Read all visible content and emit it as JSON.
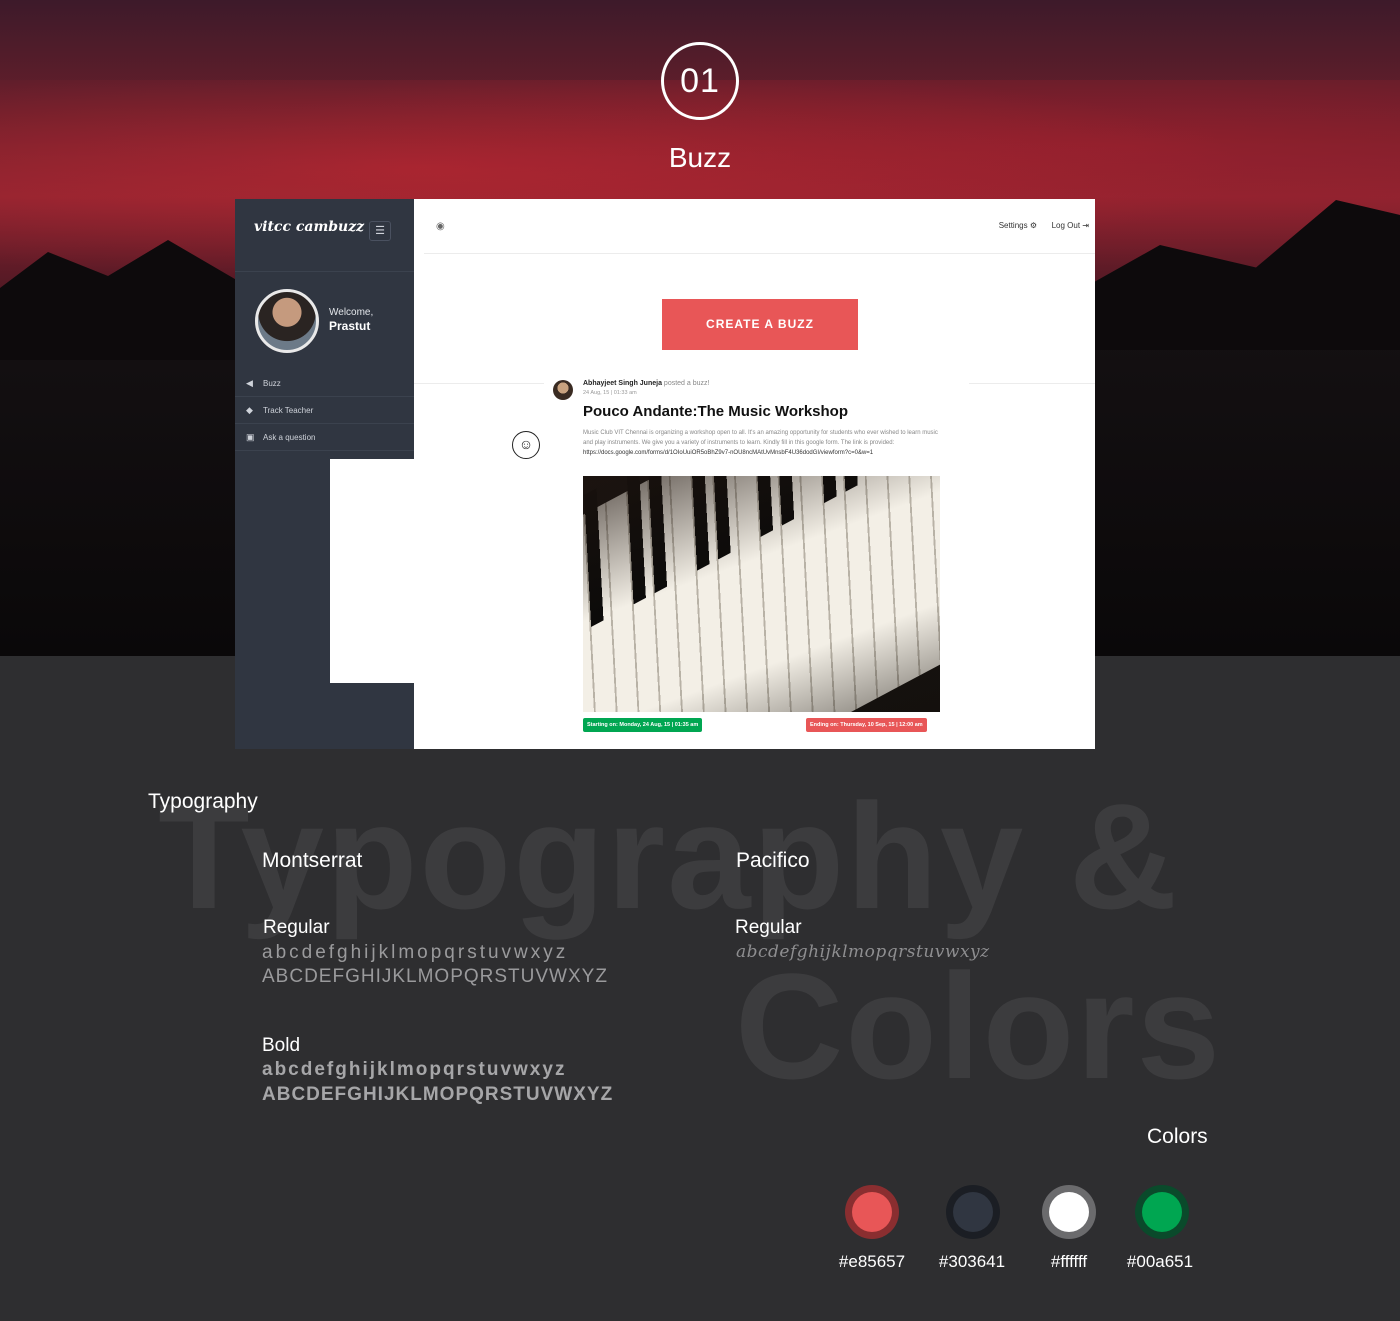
{
  "header": {
    "step_number": "01",
    "step_title": "Buzz"
  },
  "app": {
    "brand": "vitcc cambuzz",
    "menu_icon": "hamburger-icon",
    "user": {
      "welcome": "Welcome,",
      "name": "Prastut"
    },
    "nav": [
      {
        "label": "Buzz",
        "icon": "megaphone-icon"
      },
      {
        "label": "Track Teacher",
        "icon": "graduation-cap-icon"
      },
      {
        "label": "Ask a question",
        "icon": "question-screen-icon"
      }
    ],
    "topbar": {
      "settings": "Settings",
      "logout": "Log Out"
    },
    "create_button": "CREATE A BUZZ",
    "post": {
      "author": "Abhayjeet Singh Juneja",
      "verb": "posted a buzz!",
      "date": "24 Aug, 15 | 01:33 am",
      "title": "Pouco Andante:The Music Workshop",
      "body": "Music Club VIT Chennai is organizing a workshop open to all. It's an amazing opportunity for students who ever wished to learn music and play instruments. We give you a variety of instruments to learn. Kindly fill in this google form. The link is provided: ",
      "link": "https://docs.google.com/forms/d/1OIoUuiOR5oBhZ9v7-nOU8ncMAtUvMnsbF4U36dodGI/viewform?c=0&w=1",
      "start": "Starting on: Monday, 24 Aug, 15 | 01:35 am",
      "end": "Ending on: Thursday, 10 Sep, 15 | 12:00 am"
    }
  },
  "typography": {
    "label": "Typography",
    "watermark_1": "Typography &",
    "watermark_2": "Colors",
    "fonts": [
      {
        "name": "Montserrat",
        "regular_label": "Regular",
        "regular_lower": "abcdefghijklmopqrstuvwxyz",
        "regular_upper": "ABCDEFGHIJKLMOPQRSTUVWXYZ",
        "bold_label": "Bold",
        "bold_lower": "abcdefghijklmopqrstuvwxyz",
        "bold_upper": "ABCDEFGHIJKLMOPQRSTUVWXYZ"
      },
      {
        "name": "Pacifico",
        "regular_label": "Regular",
        "regular_lower": "abcdefghijklmopqrstuvwxyz"
      }
    ]
  },
  "colors": {
    "label": "Colors",
    "swatches": [
      {
        "hex": "#e85657",
        "ring": "#8a2e30"
      },
      {
        "hex": "#303641",
        "ring": "#1b1e24"
      },
      {
        "hex": "#ffffff",
        "ring": "#6b6b6d"
      },
      {
        "hex": "#00a651",
        "ring": "#0a4a2b"
      }
    ]
  }
}
